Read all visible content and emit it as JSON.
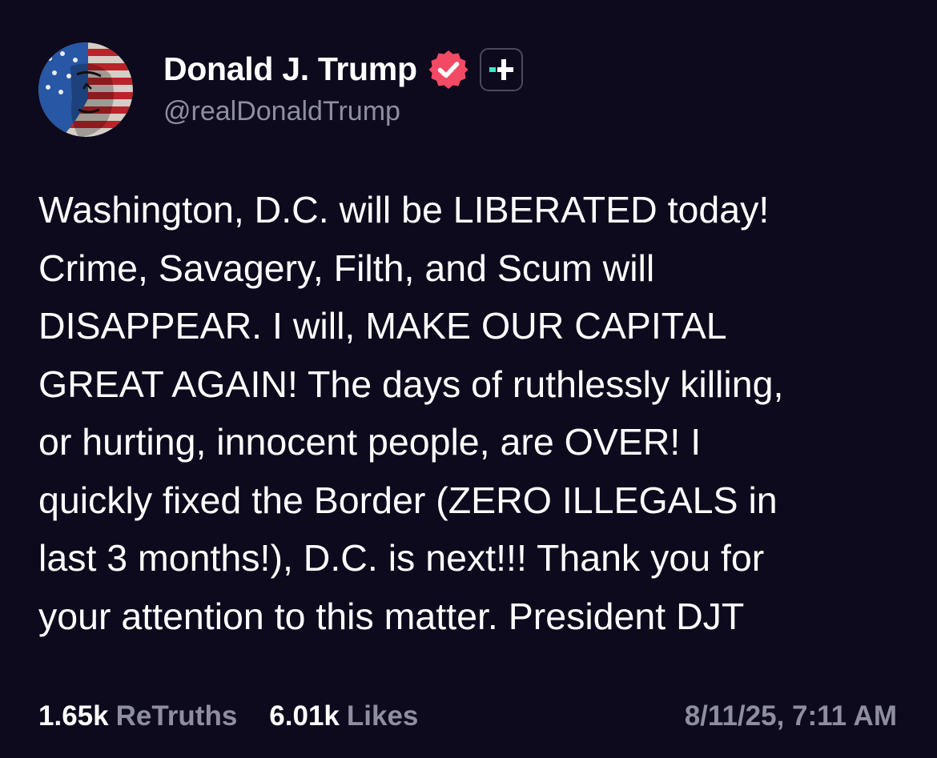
{
  "colors": {
    "background": "#0d0a1d",
    "text": "#ffffff",
    "muted": "#8e8ea0",
    "verified_badge": "#f24a64",
    "plus_accent": "#3fe3c5"
  },
  "author": {
    "display_name": "Donald J. Trump",
    "handle": "@realDonaldTrump",
    "avatar_icon": "avatar-flag-portrait",
    "verified_icon": "verified-check-icon",
    "plus_icon": "plus-icon"
  },
  "post": {
    "lines": [
      "Washington, D.C. will be LIBERATED today!",
      "Crime, Savagery, Filth, and Scum will",
      "DISAPPEAR. I will, MAKE OUR CAPITAL",
      "GREAT AGAIN! The days of ruthlessly killing,",
      "or hurting, innocent people, are OVER! I",
      "quickly fixed the Border (ZERO ILLEGALS in",
      "last 3 months!), D.C. is next!!! Thank you for",
      "your attention to this matter. President DJT"
    ]
  },
  "stats": {
    "retruths_count": "1.65k",
    "retruths_label": "ReTruths",
    "likes_count": "6.01k",
    "likes_label": "Likes",
    "timestamp": "8/11/25, 7:11 AM"
  }
}
